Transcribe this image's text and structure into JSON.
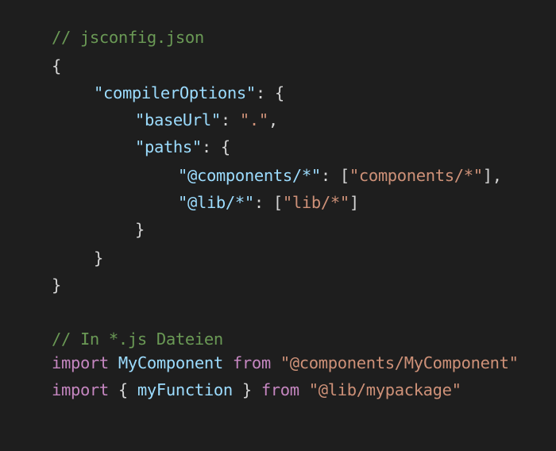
{
  "colors": {
    "background": "#1e1e1e",
    "comment": "#6a9955",
    "key": "#9cdcfe",
    "string": "#ce9178",
    "keyword": "#c586c0",
    "punctuation": "#d4d4d4"
  },
  "code": {
    "line1_comment": "// jsconfig.json",
    "open_brace": "{",
    "compiler_options_key": "\"compilerOptions\"",
    "colon_open": ": {",
    "base_url_key": "\"baseUrl\"",
    "colon": ": ",
    "base_url_value": "\".\"",
    "comma": ",",
    "paths_key": "\"paths\"",
    "components_key": "\"@components/*\"",
    "bracket_open": "[",
    "components_value": "\"components/*\"",
    "bracket_close_comma": "],",
    "lib_key": "\"@lib/*\"",
    "lib_value": "\"lib/*\"",
    "bracket_close": "]",
    "close_brace": "}",
    "comment2": "// In *.js Dateien",
    "import_kw": "import",
    "my_component": "MyComponent",
    "from_kw": "from",
    "my_component_path": "\"@components/MyComponent\"",
    "brace_open_sp": "{ ",
    "my_function": "myFunction",
    "brace_close_sp": " }",
    "mypackage_path": "\"@lib/mypackage\""
  }
}
